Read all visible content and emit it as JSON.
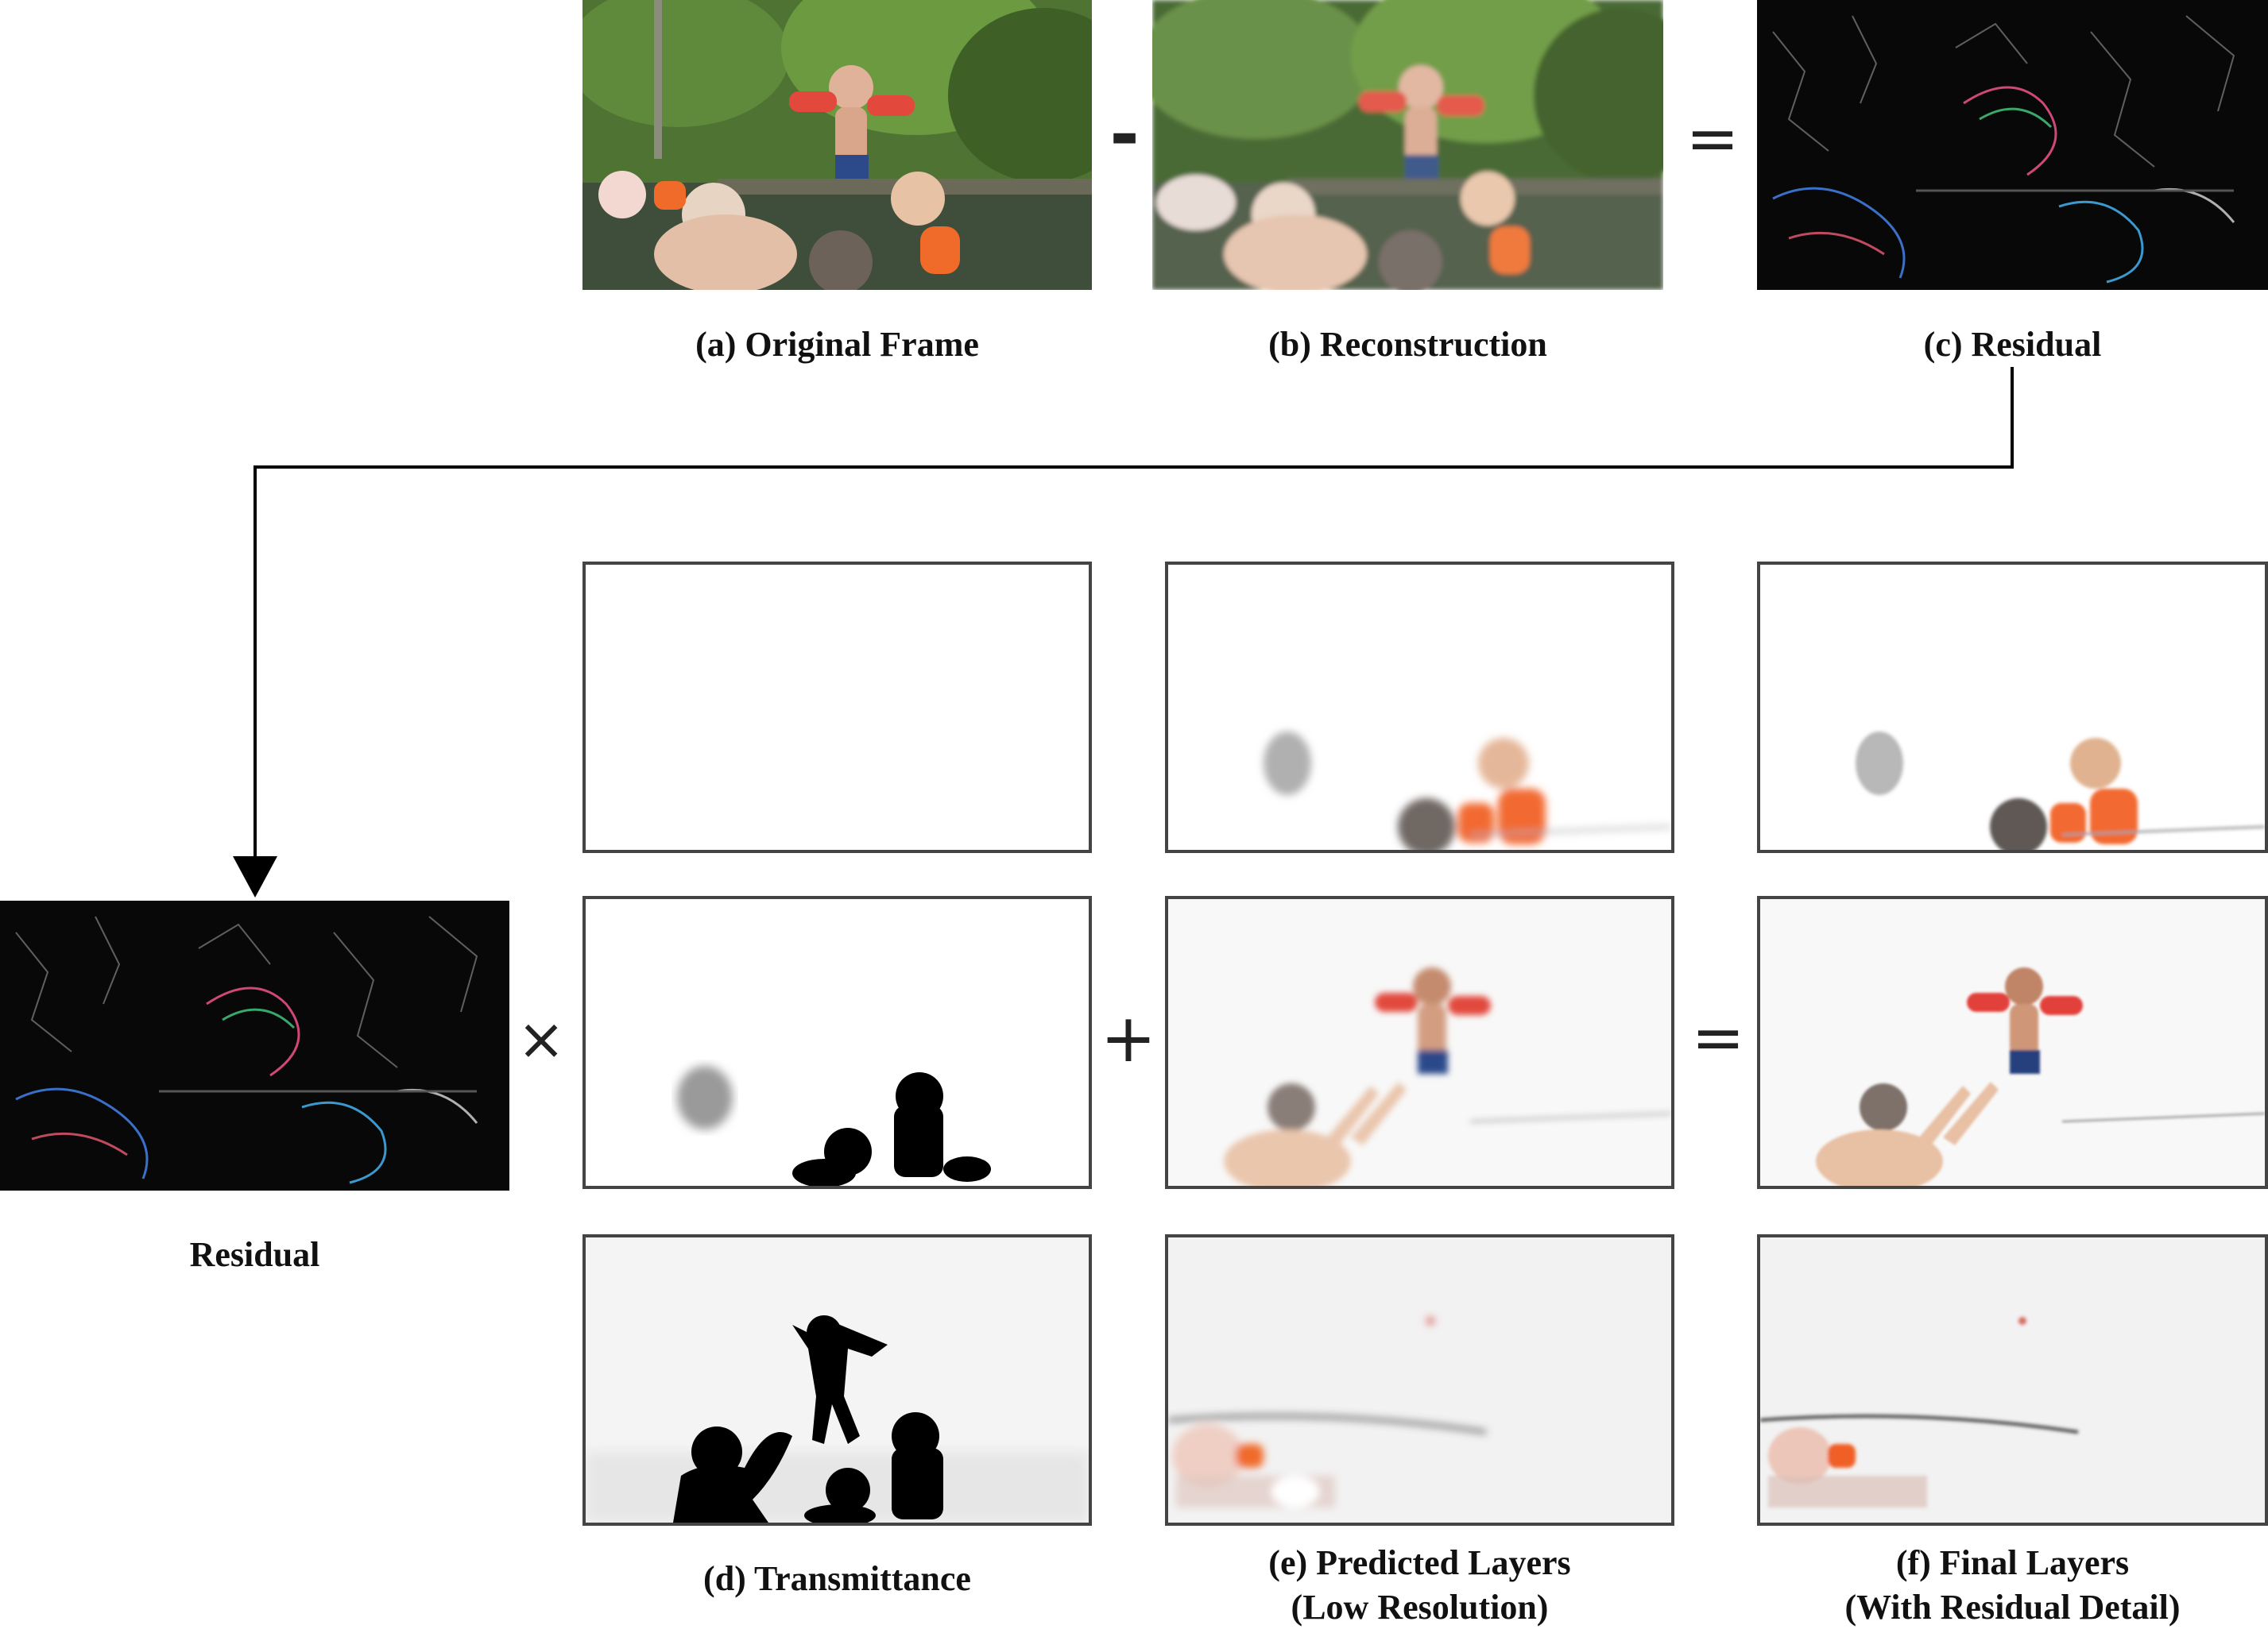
{
  "captions": {
    "a": "(a) Original Frame",
    "b": "(b) Reconstruction",
    "c": "(c) Residual",
    "residual": "Residual",
    "d": "(d) Transmittance",
    "e_line1": "(e) Predicted Layers",
    "e_line2": "(Low Resolution)",
    "f_line1": "(f) Final Layers",
    "f_line2": "(With Residual Detail)"
  },
  "operators": {
    "minus": "-",
    "equals": "=",
    "times": "×",
    "plus": "+"
  },
  "colors": {
    "border": "#444444",
    "residual_bg": "#070807",
    "arrow": "#000000"
  }
}
